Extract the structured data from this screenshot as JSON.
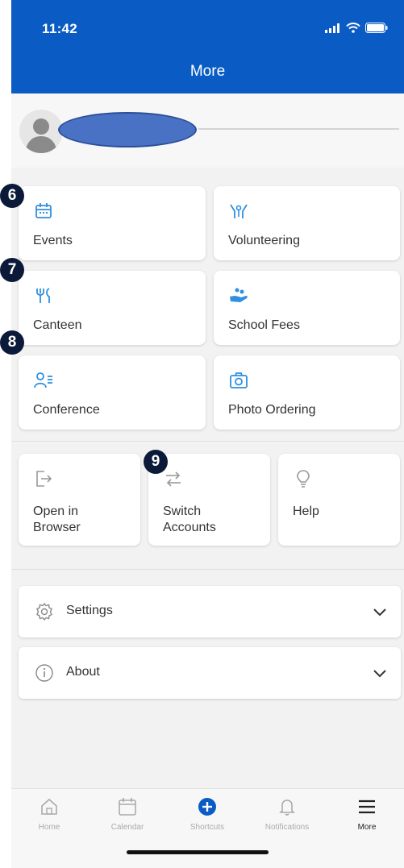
{
  "status_bar": {
    "time": "11:42"
  },
  "header": {
    "title": "More"
  },
  "tiles": [
    {
      "label": "Events",
      "icon": "calendar-icon"
    },
    {
      "label": "Volunteering",
      "icon": "volunteer-hands-icon"
    },
    {
      "label": "Canteen",
      "icon": "fork-knife-icon"
    },
    {
      "label": "School Fees",
      "icon": "coins-hand-icon"
    },
    {
      "label": "Conference",
      "icon": "person-list-icon"
    },
    {
      "label": "Photo Ordering",
      "icon": "camera-icon"
    }
  ],
  "small_tiles": [
    {
      "line1": "Open in",
      "line2": "Browser",
      "icon": "exit-browser-icon"
    },
    {
      "line1": "Switch",
      "line2": "Accounts",
      "icon": "switch-arrows-icon"
    },
    {
      "line1": "Help",
      "line2": "",
      "icon": "lightbulb-icon"
    }
  ],
  "rows": [
    {
      "label": "Settings",
      "icon": "gear-icon"
    },
    {
      "label": "About",
      "icon": "info-icon"
    }
  ],
  "tabbar": [
    {
      "label": "Home",
      "icon": "home-icon"
    },
    {
      "label": "Calendar",
      "icon": "calendar-icon"
    },
    {
      "label": "Shortcuts",
      "icon": "plus-circle-icon"
    },
    {
      "label": "Notifications",
      "icon": "bell-icon"
    },
    {
      "label": "More",
      "icon": "menu-icon"
    }
  ],
  "badges": [
    "6",
    "7",
    "8",
    "9"
  ],
  "colors": {
    "header": "#0a5cc4",
    "icon_blue": "#2f8fe0",
    "badge": "#0c1a3a",
    "redaction": "#4a72c4"
  }
}
